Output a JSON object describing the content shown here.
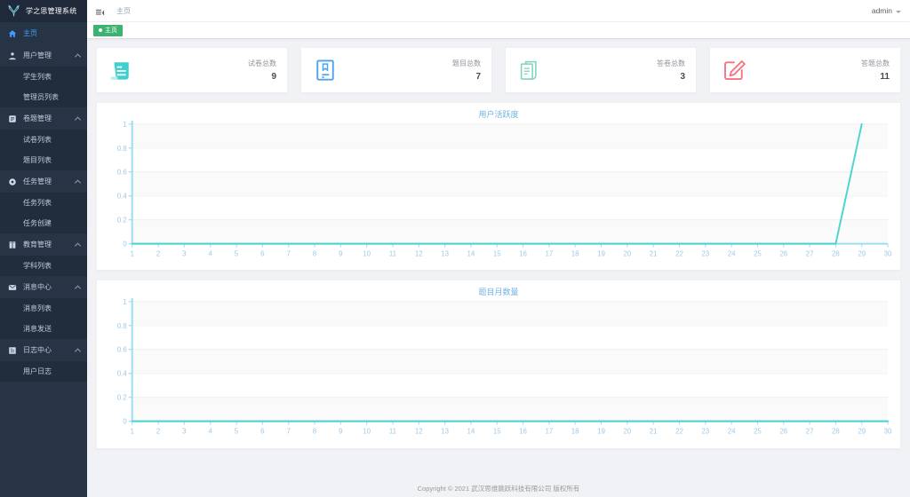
{
  "sidebar": {
    "logo_text": "学之思管理系统",
    "logo_icon": "deer-antler-logo",
    "home": {
      "label": "主页",
      "icon": "home-icon"
    },
    "groups": [
      {
        "label": "用户管理",
        "icon": "user-icon",
        "expanded": true,
        "items": [
          {
            "label": "学生列表"
          },
          {
            "label": "管理员列表"
          }
        ]
      },
      {
        "label": "卷题管理",
        "icon": "exam-icon",
        "expanded": true,
        "items": [
          {
            "label": "试卷列表"
          },
          {
            "label": "题目列表"
          }
        ]
      },
      {
        "label": "任务管理",
        "icon": "task-icon",
        "expanded": true,
        "items": [
          {
            "label": "任务列表"
          },
          {
            "label": "任务创建"
          }
        ]
      },
      {
        "label": "教育管理",
        "icon": "book-icon",
        "expanded": true,
        "items": [
          {
            "label": "学科列表"
          }
        ]
      },
      {
        "label": "消息中心",
        "icon": "mail-icon",
        "expanded": true,
        "items": [
          {
            "label": "消息列表"
          },
          {
            "label": "消息发送"
          }
        ]
      },
      {
        "label": "日志中心",
        "icon": "log-icon",
        "expanded": true,
        "items": [
          {
            "label": "用户日志"
          }
        ]
      }
    ]
  },
  "navbar": {
    "hamburger_icon": "hamburger-icon",
    "breadcrumb": "主页",
    "user_name": "admin",
    "caret_icon": "chevron-down-icon"
  },
  "tags_view": {
    "active_tag": "主页"
  },
  "cards": [
    {
      "label": "试卷总数",
      "value": "9",
      "icon": "scroll-icon",
      "color": "#3ecfcf"
    },
    {
      "label": "题目总数",
      "value": "7",
      "icon": "book-cover-icon",
      "color": "#4aa3f0"
    },
    {
      "label": "答卷总数",
      "value": "3",
      "icon": "papers-icon",
      "color": "#7fd0bd"
    },
    {
      "label": "答题总数",
      "value": "11",
      "icon": "edit-square-icon",
      "color": "#f9717f"
    }
  ],
  "chart_data": [
    {
      "type": "line",
      "title": "用户活跃度",
      "xlabel": "",
      "ylabel": "",
      "x": [
        1,
        2,
        3,
        4,
        5,
        6,
        7,
        8,
        9,
        10,
        11,
        12,
        13,
        14,
        15,
        16,
        17,
        18,
        19,
        20,
        21,
        22,
        23,
        24,
        25,
        26,
        27,
        28,
        29,
        30
      ],
      "values": [
        0,
        0,
        0,
        0,
        0,
        0,
        0,
        0,
        0,
        0,
        0,
        0,
        0,
        0,
        0,
        0,
        0,
        0,
        0,
        0,
        0,
        0,
        0,
        0,
        0,
        0,
        0,
        0,
        1,
        null
      ],
      "ytick_labels": [
        "0",
        "0.2",
        "0.4",
        "0.6",
        "0.8",
        "1"
      ],
      "yticks": [
        0,
        0.2,
        0.4,
        0.6,
        0.8,
        1
      ],
      "ylim": [
        0,
        1
      ],
      "xlim": [
        1,
        30
      ],
      "grid": true,
      "legend": "none",
      "line_color": "#4ed3d3",
      "axis_color": "#9fdcef"
    },
    {
      "type": "line",
      "title": "题目月数量",
      "xlabel": "",
      "ylabel": "",
      "x": [
        1,
        2,
        3,
        4,
        5,
        6,
        7,
        8,
        9,
        10,
        11,
        12,
        13,
        14,
        15,
        16,
        17,
        18,
        19,
        20,
        21,
        22,
        23,
        24,
        25,
        26,
        27,
        28,
        29,
        30
      ],
      "values": [
        0,
        0,
        0,
        0,
        0,
        0,
        0,
        0,
        0,
        0,
        0,
        0,
        0,
        0,
        0,
        0,
        0,
        0,
        0,
        0,
        0,
        0,
        0,
        0,
        0,
        0,
        0,
        0,
        0,
        0
      ],
      "ytick_labels": [
        "0",
        "0.2",
        "0.4",
        "0.6",
        "0.8",
        "1"
      ],
      "yticks": [
        0,
        0.2,
        0.4,
        0.6,
        0.8,
        1
      ],
      "ylim": [
        0,
        1
      ],
      "xlim": [
        1,
        30
      ],
      "grid": true,
      "legend": "none",
      "line_color": "#4ed3d3",
      "axis_color": "#9fdcef"
    }
  ],
  "footer": {
    "text": "Copyright © 2021 武汉思维跳跃科技有限公司 版权所有"
  }
}
